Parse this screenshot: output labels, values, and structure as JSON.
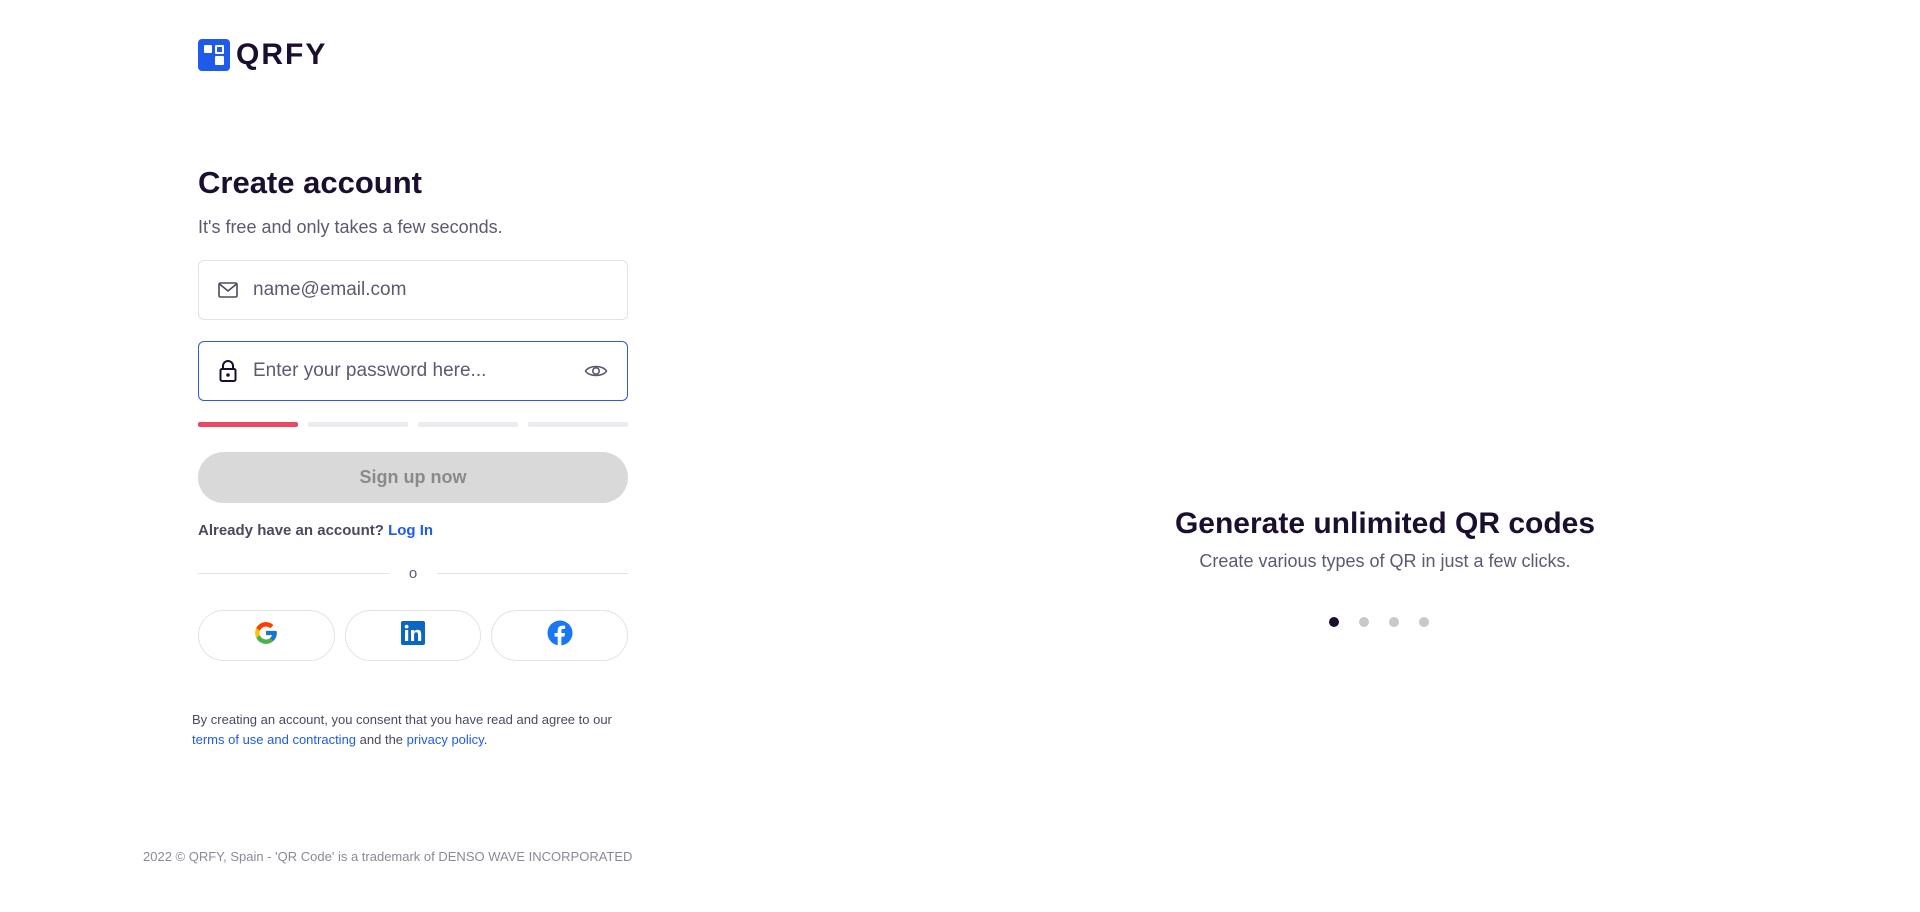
{
  "brand": {
    "name": "QRFY",
    "accent_color": "#1f5bea"
  },
  "form": {
    "heading": "Create account",
    "subheading": "It's free and only takes a few seconds.",
    "email": {
      "value": "",
      "placeholder": "name@email.com",
      "icon": "mail-icon"
    },
    "password": {
      "value": "",
      "placeholder": "Enter your password here...",
      "icon": "lock-icon",
      "toggle_icon": "eye-icon"
    },
    "password_strength": {
      "segments": 4,
      "filled": 1,
      "filled_color": "#ec4866"
    },
    "signup_label": "Sign up now",
    "login_prompt": "Already have an account?",
    "login_link": "Log In",
    "divider_text": "o",
    "social": [
      {
        "name": "google",
        "icon": "google-icon"
      },
      {
        "name": "linkedin",
        "icon": "linkedin-icon"
      },
      {
        "name": "facebook",
        "icon": "facebook-icon"
      }
    ]
  },
  "consent": {
    "text_before": "By creating an account, you consent that you have read and agree to our",
    "terms_link": "terms of use and contracting",
    "text_middle": "and the",
    "privacy_link": "privacy policy",
    "text_end": "."
  },
  "footer": {
    "text": "2022 © QRFY, Spain - 'QR Code' is a trademark of DENSO WAVE INCORPORATED"
  },
  "hero": {
    "title": "Generate unlimited QR codes",
    "subtitle": "Create various types of QR in just a few clicks.",
    "slide_count": 4,
    "active_slide": 1
  }
}
